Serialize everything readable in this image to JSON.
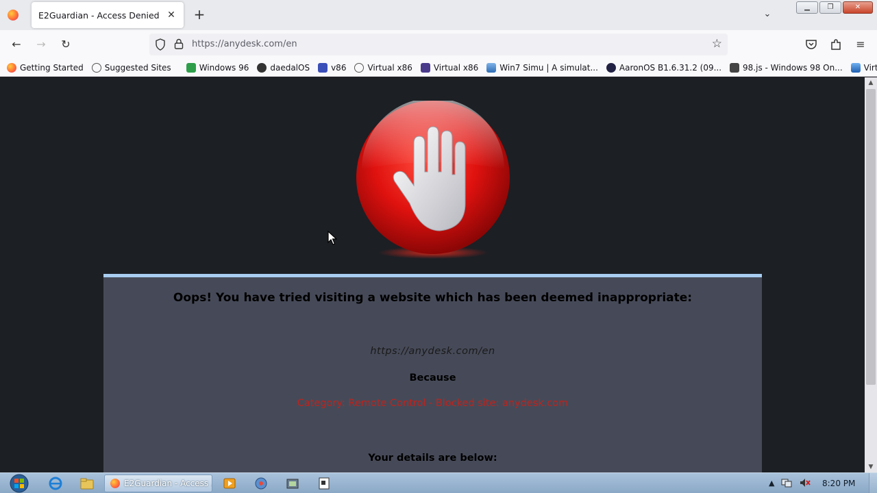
{
  "browser": {
    "tab_title": "E2Guardian - Access Denied",
    "new_tab_icon": "plus-icon",
    "url": "https://anydesk.com/en"
  },
  "bookmarks": [
    {
      "label": "Getting Started",
      "icon": "firefox-icon",
      "color": "#ff7139"
    },
    {
      "label": "Suggested Sites",
      "icon": "globe-icon",
      "color": "#555555"
    },
    {
      "label": "Windows 96",
      "icon": "windows96-icon",
      "color": "#2e9e4a"
    },
    {
      "label": "daedalOS",
      "icon": "daedalos-icon",
      "color": "#333333"
    },
    {
      "label": "v86",
      "icon": "v86-icon",
      "color": "#3b4fb8"
    },
    {
      "label": "Virtual x86",
      "icon": "globe-icon",
      "color": "#555555"
    },
    {
      "label": "Virtual x86",
      "icon": "space-invader-icon",
      "color": "#4a3a8c"
    },
    {
      "label": "Win7 Simu | A simulat...",
      "icon": "win7-icon",
      "color": "#2f6db5"
    },
    {
      "label": "AaronOS B1.6.31.2 (09...",
      "icon": "aaronos-icon",
      "color": "#222244"
    },
    {
      "label": "98.js - Windows 98 On...",
      "icon": "windows98-icon",
      "color": "#444444"
    },
    {
      "label": "VirtualXP",
      "icon": "virtualxp-icon",
      "color": "#1f5fb0"
    }
  ],
  "page": {
    "headline": "Oops! You have tried visiting a website which has been deemed inappropriate:",
    "blocked_url": "https://anydesk.com/en",
    "because_label": "Because",
    "reason": "Category: Remote Control - Blocked site: anydesk.com",
    "details_label": "Your details are below:"
  },
  "taskbar": {
    "active_window": "E2Guardian - Access ...",
    "clock": "8:20 PM"
  },
  "colors": {
    "page_background": "#1c1f24",
    "panel_background": "#464a58",
    "panel_border": "#a8cdf0",
    "reason_text": "#c0221c"
  }
}
